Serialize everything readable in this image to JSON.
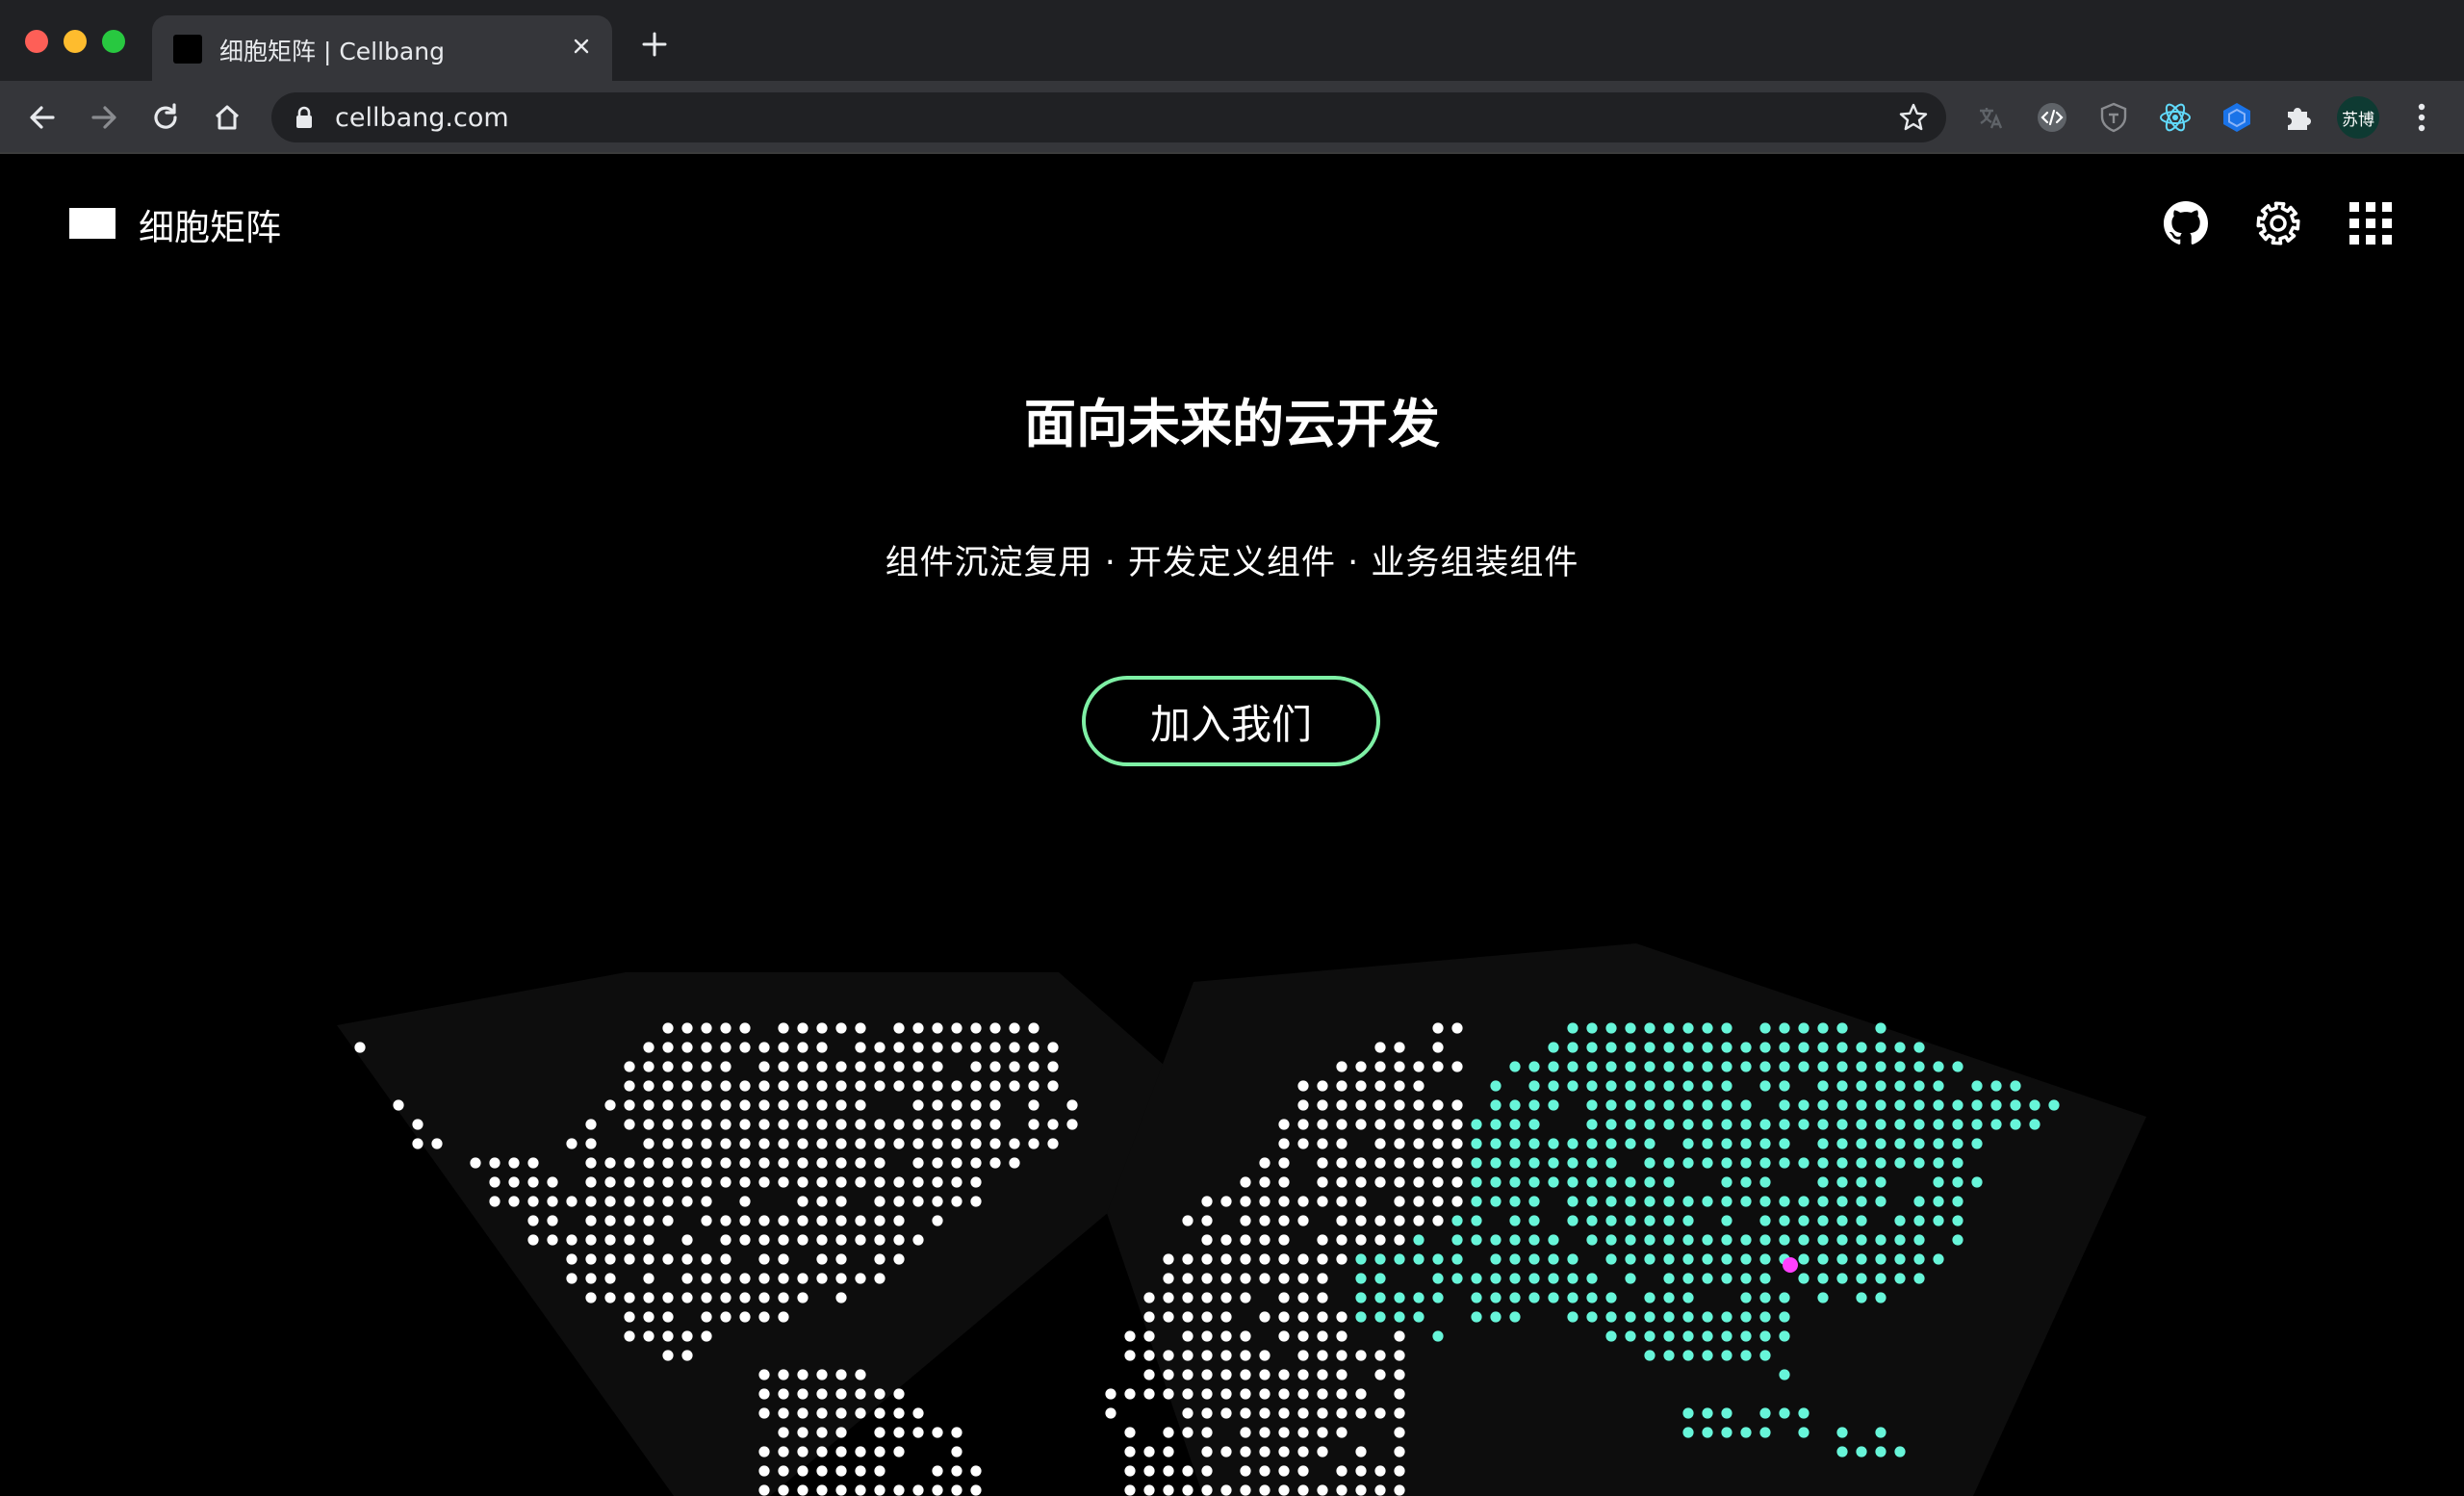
{
  "browser": {
    "tab": {
      "title": "细胞矩阵 | Cellbang"
    },
    "address_bar": {
      "url": "cellbang.com"
    },
    "profile": {
      "label": "苏博"
    },
    "extensions": [
      "translate-extension-icon",
      "code-extension-icon",
      "shield-extension-icon",
      "react-devtools-icon",
      "cube-extension-icon",
      "puzzle-extensions-icon"
    ]
  },
  "site": {
    "brand": "细胞矩阵",
    "header_icons": [
      "github-icon",
      "gear-icon",
      "apps-grid-icon"
    ]
  },
  "hero": {
    "title": "面向未来的云开发",
    "subtitle": "组件沉淀复用 · 开发定义组件 · 业务组装组件",
    "cta_label": "加入我们"
  },
  "world_map": {
    "dot_color_default": "#ffffff",
    "dot_color_highlight": "#67f5d9",
    "marker_color": "#ff40ff",
    "highlighted_region": "Asia",
    "marker_location": "China (Hangzhou)"
  },
  "colors": {
    "accent": "#7ef0a5",
    "chrome_dark": "#202124",
    "chrome_toolbar": "#35363a"
  }
}
